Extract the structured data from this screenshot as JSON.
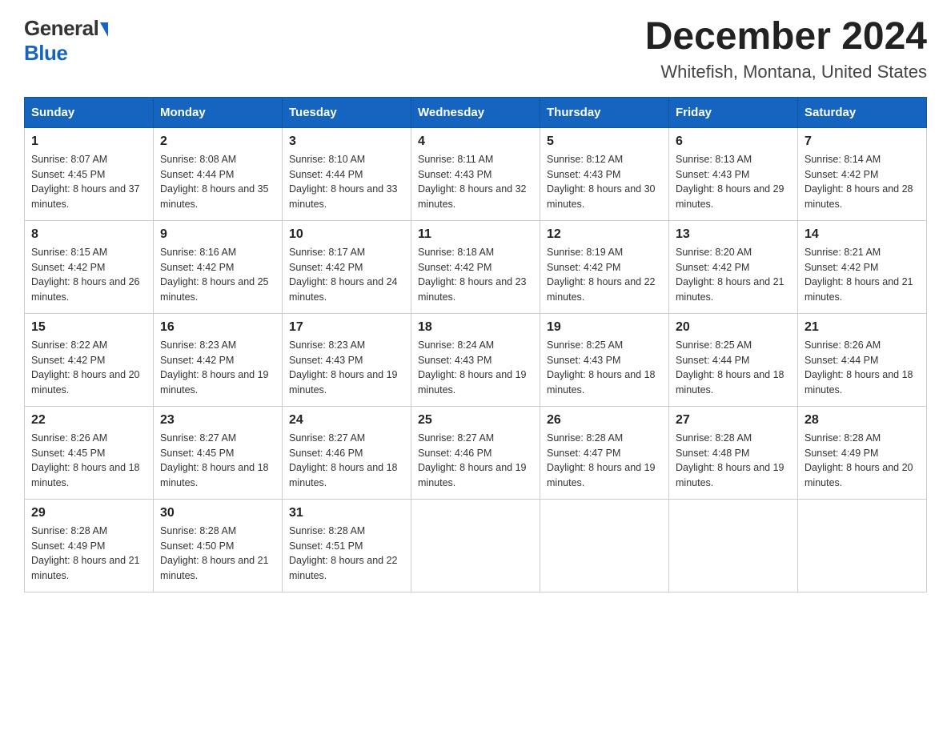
{
  "header": {
    "logo_general": "General",
    "logo_blue": "Blue",
    "month_title": "December 2024",
    "location": "Whitefish, Montana, United States"
  },
  "days_of_week": [
    "Sunday",
    "Monday",
    "Tuesday",
    "Wednesday",
    "Thursday",
    "Friday",
    "Saturday"
  ],
  "weeks": [
    [
      {
        "day": "1",
        "sunrise": "8:07 AM",
        "sunset": "4:45 PM",
        "daylight": "8 hours and 37 minutes."
      },
      {
        "day": "2",
        "sunrise": "8:08 AM",
        "sunset": "4:44 PM",
        "daylight": "8 hours and 35 minutes."
      },
      {
        "day": "3",
        "sunrise": "8:10 AM",
        "sunset": "4:44 PM",
        "daylight": "8 hours and 33 minutes."
      },
      {
        "day": "4",
        "sunrise": "8:11 AM",
        "sunset": "4:43 PM",
        "daylight": "8 hours and 32 minutes."
      },
      {
        "day": "5",
        "sunrise": "8:12 AM",
        "sunset": "4:43 PM",
        "daylight": "8 hours and 30 minutes."
      },
      {
        "day": "6",
        "sunrise": "8:13 AM",
        "sunset": "4:43 PM",
        "daylight": "8 hours and 29 minutes."
      },
      {
        "day": "7",
        "sunrise": "8:14 AM",
        "sunset": "4:42 PM",
        "daylight": "8 hours and 28 minutes."
      }
    ],
    [
      {
        "day": "8",
        "sunrise": "8:15 AM",
        "sunset": "4:42 PM",
        "daylight": "8 hours and 26 minutes."
      },
      {
        "day": "9",
        "sunrise": "8:16 AM",
        "sunset": "4:42 PM",
        "daylight": "8 hours and 25 minutes."
      },
      {
        "day": "10",
        "sunrise": "8:17 AM",
        "sunset": "4:42 PM",
        "daylight": "8 hours and 24 minutes."
      },
      {
        "day": "11",
        "sunrise": "8:18 AM",
        "sunset": "4:42 PM",
        "daylight": "8 hours and 23 minutes."
      },
      {
        "day": "12",
        "sunrise": "8:19 AM",
        "sunset": "4:42 PM",
        "daylight": "8 hours and 22 minutes."
      },
      {
        "day": "13",
        "sunrise": "8:20 AM",
        "sunset": "4:42 PM",
        "daylight": "8 hours and 21 minutes."
      },
      {
        "day": "14",
        "sunrise": "8:21 AM",
        "sunset": "4:42 PM",
        "daylight": "8 hours and 21 minutes."
      }
    ],
    [
      {
        "day": "15",
        "sunrise": "8:22 AM",
        "sunset": "4:42 PM",
        "daylight": "8 hours and 20 minutes."
      },
      {
        "day": "16",
        "sunrise": "8:23 AM",
        "sunset": "4:42 PM",
        "daylight": "8 hours and 19 minutes."
      },
      {
        "day": "17",
        "sunrise": "8:23 AM",
        "sunset": "4:43 PM",
        "daylight": "8 hours and 19 minutes."
      },
      {
        "day": "18",
        "sunrise": "8:24 AM",
        "sunset": "4:43 PM",
        "daylight": "8 hours and 19 minutes."
      },
      {
        "day": "19",
        "sunrise": "8:25 AM",
        "sunset": "4:43 PM",
        "daylight": "8 hours and 18 minutes."
      },
      {
        "day": "20",
        "sunrise": "8:25 AM",
        "sunset": "4:44 PM",
        "daylight": "8 hours and 18 minutes."
      },
      {
        "day": "21",
        "sunrise": "8:26 AM",
        "sunset": "4:44 PM",
        "daylight": "8 hours and 18 minutes."
      }
    ],
    [
      {
        "day": "22",
        "sunrise": "8:26 AM",
        "sunset": "4:45 PM",
        "daylight": "8 hours and 18 minutes."
      },
      {
        "day": "23",
        "sunrise": "8:27 AM",
        "sunset": "4:45 PM",
        "daylight": "8 hours and 18 minutes."
      },
      {
        "day": "24",
        "sunrise": "8:27 AM",
        "sunset": "4:46 PM",
        "daylight": "8 hours and 18 minutes."
      },
      {
        "day": "25",
        "sunrise": "8:27 AM",
        "sunset": "4:46 PM",
        "daylight": "8 hours and 19 minutes."
      },
      {
        "day": "26",
        "sunrise": "8:28 AM",
        "sunset": "4:47 PM",
        "daylight": "8 hours and 19 minutes."
      },
      {
        "day": "27",
        "sunrise": "8:28 AM",
        "sunset": "4:48 PM",
        "daylight": "8 hours and 19 minutes."
      },
      {
        "day": "28",
        "sunrise": "8:28 AM",
        "sunset": "4:49 PM",
        "daylight": "8 hours and 20 minutes."
      }
    ],
    [
      {
        "day": "29",
        "sunrise": "8:28 AM",
        "sunset": "4:49 PM",
        "daylight": "8 hours and 21 minutes."
      },
      {
        "day": "30",
        "sunrise": "8:28 AM",
        "sunset": "4:50 PM",
        "daylight": "8 hours and 21 minutes."
      },
      {
        "day": "31",
        "sunrise": "8:28 AM",
        "sunset": "4:51 PM",
        "daylight": "8 hours and 22 minutes."
      },
      null,
      null,
      null,
      null
    ]
  ],
  "labels": {
    "sunrise": "Sunrise: ",
    "sunset": "Sunset: ",
    "daylight": "Daylight: "
  }
}
